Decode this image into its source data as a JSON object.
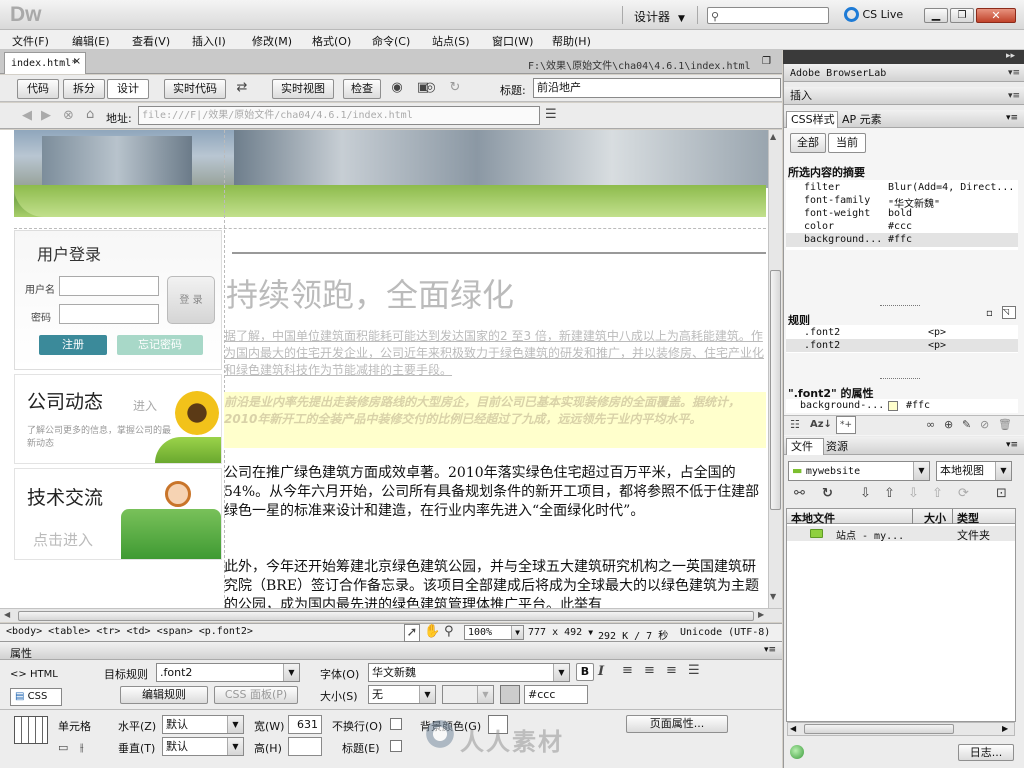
{
  "app": {
    "logo": "Dw",
    "workspace": "设计器",
    "search_placeholder": "",
    "cslive": "CS Live"
  },
  "menu": [
    "文件(F)",
    "编辑(E)",
    "查看(V)",
    "插入(I)",
    "修改(M)",
    "格式(O)",
    "命令(C)",
    "站点(S)",
    "窗口(W)",
    "帮助(H)"
  ],
  "doc": {
    "tab": "index.html*",
    "path": "F:\\效果\\原始文件\\cha04\\4.6.1\\index.html"
  },
  "toolbar": {
    "code": "代码",
    "split": "拆分",
    "design": "设计",
    "live_code": "实时代码",
    "live_view": "实时视图",
    "inspect": "检查",
    "title_label": "标题:",
    "title_value": "前沿地产"
  },
  "address": {
    "label": "地址:",
    "value": "file:///F|/效果/原始文件/cha04/4.6.1/index.html"
  },
  "page": {
    "login": {
      "title": "用户登录",
      "username_label": "用户名",
      "password_label": "密码",
      "login_btn": "登 录",
      "register_btn": "注册",
      "forgot_btn": "忘记密码"
    },
    "news": {
      "title": "公司动态",
      "enter": "进入",
      "desc": "了解公司更多的信息，掌握公司的最新动态"
    },
    "exchange": {
      "title": "技术交流",
      "enter": "点击进入"
    },
    "heading": "持续领跑，全面绿化",
    "para1": "据了解，中国单位建筑面积能耗可能达到发达国家的2 至3 倍，新建建筑中八成以上为高耗能建筑。作为国内最大的住宅开发企业，公司近年来积极致力于绿色建筑的研发和推广，并以装修房、住宅产业化和绿色建筑科技作为节能减排的主要手段。",
    "para2": "前沿是业内率先提出走装修房路线的大型房企，目前公司已基本实现装修房的全面覆盖。据统计，2010年新开工的全装产品中装修交付的比例已经超过了九成，远远领先于业内平均水平。",
    "para3": "公司在推广绿色建筑方面成效卓著。2010年落实绿色住宅超过百万平米，占全国的54%。从今年六月开始，公司所有具备规划条件的新开工项目，都将参照不低于住建部绿色一星的标准来设计和建造，在行业内率先进入“全面绿化时代”。",
    "para4": "此外，今年还开始筹建北京绿色建筑公园，并与全球五大建筑研究机构之一英国建筑研究院（BRE）签订合作备忘录。该项目全部建成后将成为全球最大的以绿色建筑为主题的公园，成为国内最先进的绿色建筑管理体推广平台。此举有"
  },
  "status": {
    "tags": [
      "<body>",
      "<table>",
      "<tr>",
      "<td>",
      "<span>",
      "<p.font2>"
    ],
    "zoom": "100%",
    "size": "777 x 492",
    "filesize": "292 K / 7 秒",
    "encoding": "Unicode (UTF-8)"
  },
  "panels": {
    "browserlab": "Adobe BrowserLab",
    "insert": "插入",
    "css_tabs": [
      "CSS样式",
      "AP 元素"
    ],
    "all_btn": "全部",
    "current_btn": "当前",
    "summary_title": "所选内容的摘要",
    "props": [
      {
        "name": "filter",
        "value": "Blur(Add=4, Direct..."
      },
      {
        "name": "font-family",
        "value": "\"华文新魏\""
      },
      {
        "name": "font-weight",
        "value": "bold"
      },
      {
        "name": "color",
        "value": "#ccc"
      },
      {
        "name": "background...",
        "value": "#ffc"
      }
    ],
    "rules_title": "规则",
    "rules": [
      {
        "sel": ".font2",
        "tag": "<p>"
      },
      {
        "sel": ".font2",
        "tag": "<p>"
      }
    ],
    "font2_title": "\".font2\" 的属性",
    "font2_prop": {
      "name": "background-...",
      "value": "#ffc"
    },
    "files_tabs": [
      "文件",
      "资源"
    ],
    "site": "mywebsite",
    "view": "本地视图",
    "file_cols": [
      "本地文件",
      "大小",
      "类型"
    ],
    "file_row": {
      "name": "站点 - my...",
      "type": "文件夹"
    },
    "log_btn": "日志..."
  },
  "props": {
    "title": "属性",
    "html": "HTML",
    "css": "CSS",
    "target_rule_label": "目标规则",
    "target_rule": ".font2",
    "edit_rule": "编辑规则",
    "css_panel": "CSS 面板(P)",
    "font_label": "字体(O)",
    "font": "华文新魏",
    "size_label": "大小(S)",
    "size": "无",
    "color": "#ccc",
    "cell_label": "单元格",
    "horz_label": "水平(Z)",
    "horz": "默认",
    "vert_label": "垂直(T)",
    "vert": "默认",
    "width_label": "宽(W)",
    "width": "631",
    "height_label": "高(H)",
    "nowrap_label": "不换行(O)",
    "bg_label": "背景颜色(G)",
    "header_label": "标题(E)",
    "page_props": "页面属性..."
  },
  "watermark": "人人素材",
  "colors": {
    "accent": "#1d5ea8",
    "login_btn": "#3b8a9a",
    "forgot_btn": "#a8d8c8",
    "highlight": "#ffffcc"
  }
}
